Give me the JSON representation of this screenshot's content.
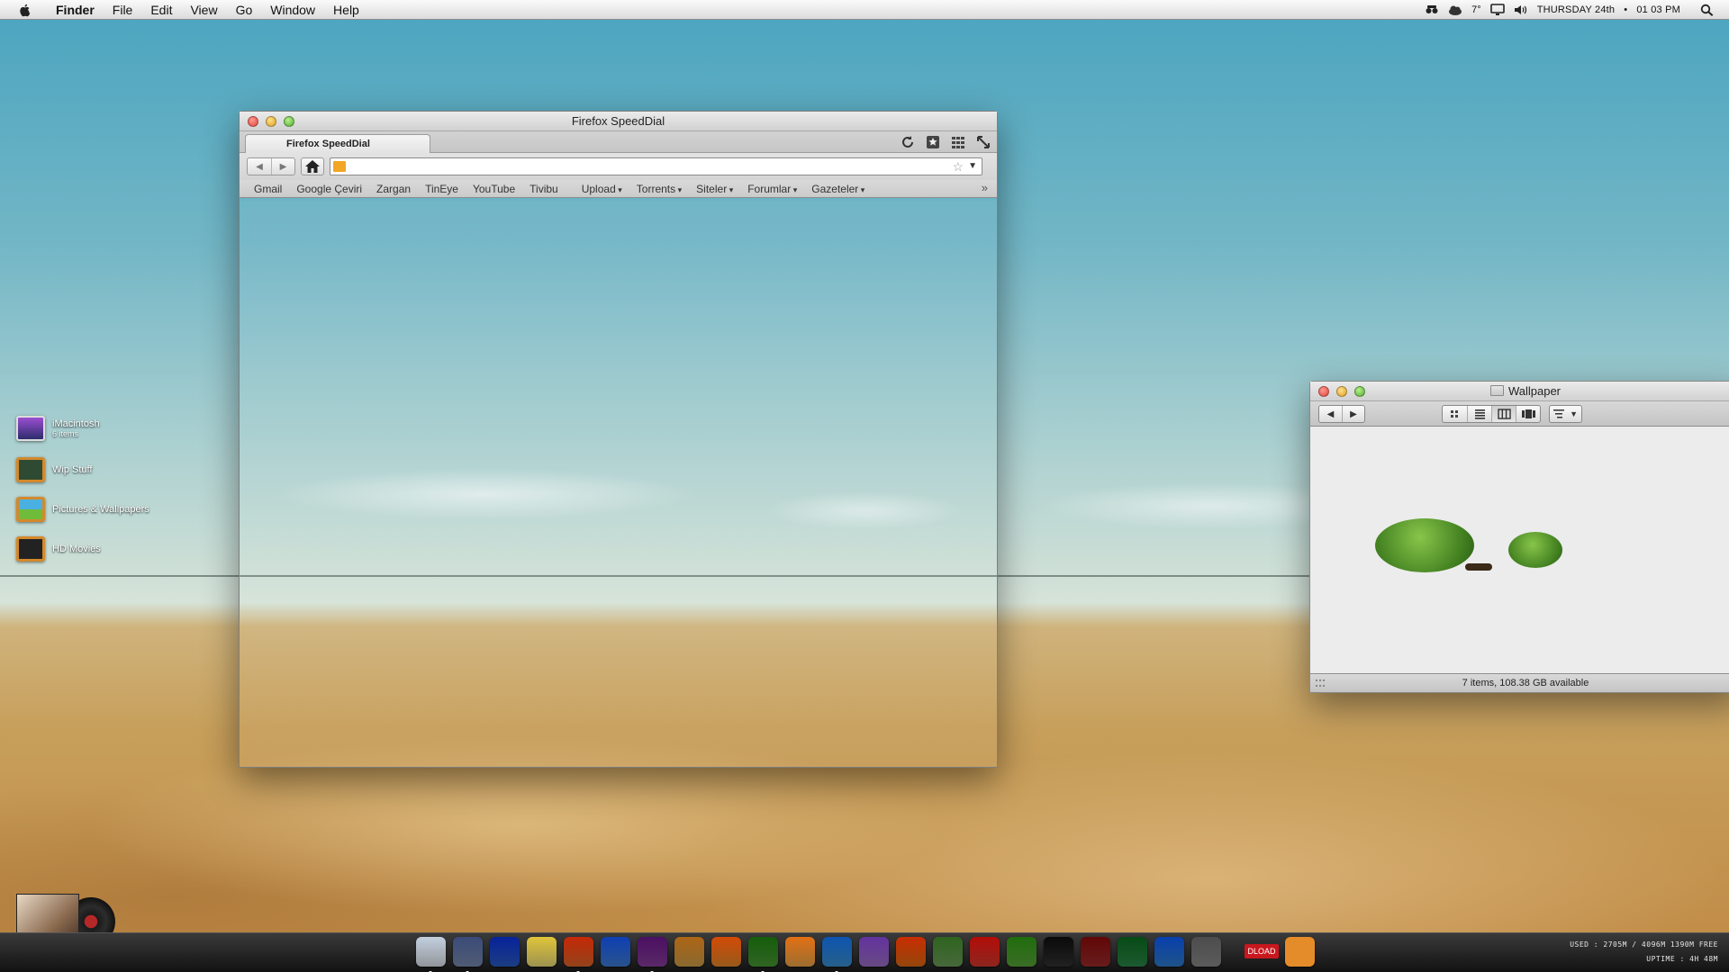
{
  "menubar": {
    "app_name": "Finder",
    "items": [
      "File",
      "Edit",
      "View",
      "Go",
      "Window",
      "Help"
    ],
    "weather_temp": "7°",
    "clock_day": "THURSDAY 24th",
    "clock_separator": "•",
    "clock_time": "01 03 PM"
  },
  "desktop_icons": [
    {
      "label": "iMacintosh",
      "sub": "6 items",
      "icon": "imac-icon"
    },
    {
      "label": "Wip Stuff",
      "icon": "chalkboard-folder-icon"
    },
    {
      "label": "Pictures & Wallpapers",
      "icon": "pictures-folder-icon"
    },
    {
      "label": "HD Movies",
      "icon": "movies-folder-icon"
    }
  ],
  "firefox": {
    "window_title": "Firefox SpeedDial",
    "tab_label": "Firefox SpeedDial",
    "url": "",
    "bookmarks": [
      {
        "label": "Gmail",
        "folder": false
      },
      {
        "label": "Google Çeviri",
        "folder": false
      },
      {
        "label": "Zargan",
        "folder": false
      },
      {
        "label": "TinEye",
        "folder": false
      },
      {
        "label": "YouTube",
        "folder": false
      },
      {
        "label": "Tivibu",
        "folder": false
      },
      {
        "label": "Upload",
        "folder": true
      },
      {
        "label": "Torrents",
        "folder": true
      },
      {
        "label": "Siteler",
        "folder": true
      },
      {
        "label": "Forumlar",
        "folder": true
      },
      {
        "label": "Gazeteler",
        "folder": true
      }
    ],
    "more_bookmarks": "»"
  },
  "finder": {
    "window_title": "Wallpaper",
    "status": "7 items, 108.38 GB available"
  },
  "dock": {
    "apps": [
      {
        "name": "finder-icon",
        "color": "#dfe6ee",
        "running": true
      },
      {
        "name": "mission-control-icon",
        "color": "#7b8bb0",
        "running": true
      },
      {
        "name": "pen-app-icon",
        "color": "#2b5ec7",
        "running": false
      },
      {
        "name": "notes-icon",
        "color": "#efe07a",
        "running": false
      },
      {
        "name": "firefox-icon",
        "color": "#e0662a",
        "running": true
      },
      {
        "name": "xcode-icon",
        "color": "#3e7fd6",
        "running": false
      },
      {
        "name": "itunes-icon",
        "color": "#8a3f9e",
        "running": true
      },
      {
        "name": "gift-icon",
        "color": "#d2a14a",
        "running": false
      },
      {
        "name": "photo-effects-icon",
        "color": "#e88a2a",
        "running": false
      },
      {
        "name": "growl-icon",
        "color": "#4a9a35",
        "running": true
      },
      {
        "name": "pages-icon",
        "color": "#f0a949",
        "running": false
      },
      {
        "name": "preview-icon",
        "color": "#3b93d3",
        "running": true
      },
      {
        "name": "messages-icon",
        "color": "#9f72c9",
        "running": false
      },
      {
        "name": "vlc-icon",
        "color": "#e26c12",
        "running": false
      },
      {
        "name": "utility-icon",
        "color": "#6da05a",
        "running": false
      },
      {
        "name": "calendar-icon",
        "color": "#d63a2f",
        "running": false
      },
      {
        "name": "tree-app-icon",
        "color": "#5aa73a",
        "running": false
      },
      {
        "name": "clapper-icon",
        "color": "#333333",
        "running": false
      },
      {
        "name": "microphone-icon",
        "color": "#9e2b2b",
        "running": false
      },
      {
        "name": "stocks-icon",
        "color": "#2c8a4a",
        "running": false
      },
      {
        "name": "app-store-icon",
        "color": "#2f7fd2",
        "running": false
      },
      {
        "name": "system-preferences-icon",
        "color": "#8c8c8c",
        "running": false
      }
    ],
    "dload_label": "DLOAD",
    "last_app": {
      "name": "trash-icon",
      "color": "#e58c2a"
    }
  },
  "system_stats": {
    "memory": "USED : 2705M / 4096M   1390M FREE",
    "uptime": "UPTIME : 4H 48M"
  }
}
